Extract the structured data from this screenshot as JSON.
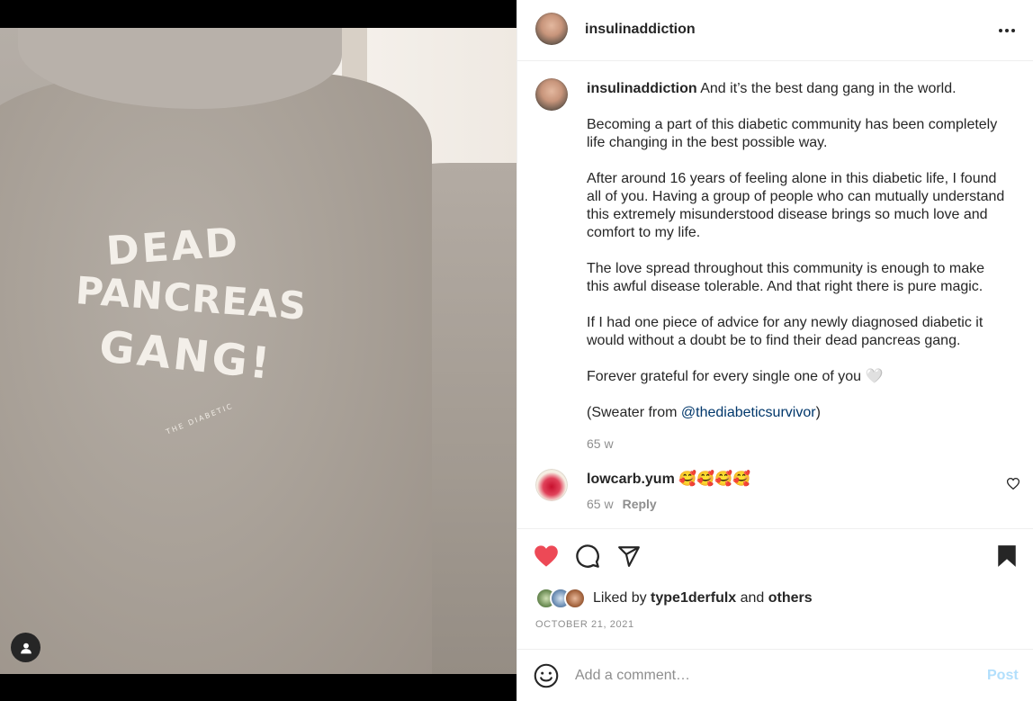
{
  "media": {
    "print_line_1": "DEAD",
    "print_line_2": "PANCREAS",
    "print_line_3": "GANG!",
    "print_brand": "THE DIABETIC",
    "tag_icon": "user-tag-icon"
  },
  "header": {
    "username": "insulinaddiction",
    "more_icon": "more-horizontal-icon"
  },
  "caption": {
    "username": "insulinaddiction",
    "first_line": " And it’s the best dang gang in the world.",
    "para_1": "Becoming a part of this diabetic community has been completely life changing in the best possible way.",
    "para_2": "After around 16 years of feeling alone in this diabetic life, I found all of you. Having a group of people who can mutually understand this extremely misunderstood disease brings so much love and comfort to my life.",
    "para_3": "The love spread throughout this community is enough to make this awful disease tolerable. And that right there is pure magic.",
    "para_4": "If I had one piece of advice for any newly diagnosed diabetic it would without a doubt be to find their dead pancreas gang.",
    "para_5": "Forever grateful for every single one of you 🤍",
    "sweater_prefix": "(Sweater from ",
    "sweater_mention": "@thediabeticsurvivor",
    "sweater_suffix": ")",
    "time": "65 w"
  },
  "comment": {
    "username": "lowcarb.yum",
    "text": " 🥰🥰🥰🥰",
    "time": "65 w",
    "reply_label": "Reply",
    "like_icon": "heart-outline-icon"
  },
  "actions": {
    "like_icon": "heart-filled-icon",
    "comment_icon": "comment-icon",
    "share_icon": "send-icon",
    "save_icon": "bookmark-filled-icon",
    "liked_by_prefix": "Liked by ",
    "liked_by_user": "type1derfulx",
    "liked_by_and": " and ",
    "liked_by_others": "others",
    "date": "OCTOBER 21, 2021"
  },
  "add_comment": {
    "placeholder": "Add a comment…",
    "post_label": "Post",
    "emoji_icon": "smiley-icon"
  },
  "colors": {
    "like_red": "#ed4956",
    "mention_blue": "#00376b",
    "post_disabled": "#b2dffc",
    "secondary_text": "#8e8e8e"
  }
}
